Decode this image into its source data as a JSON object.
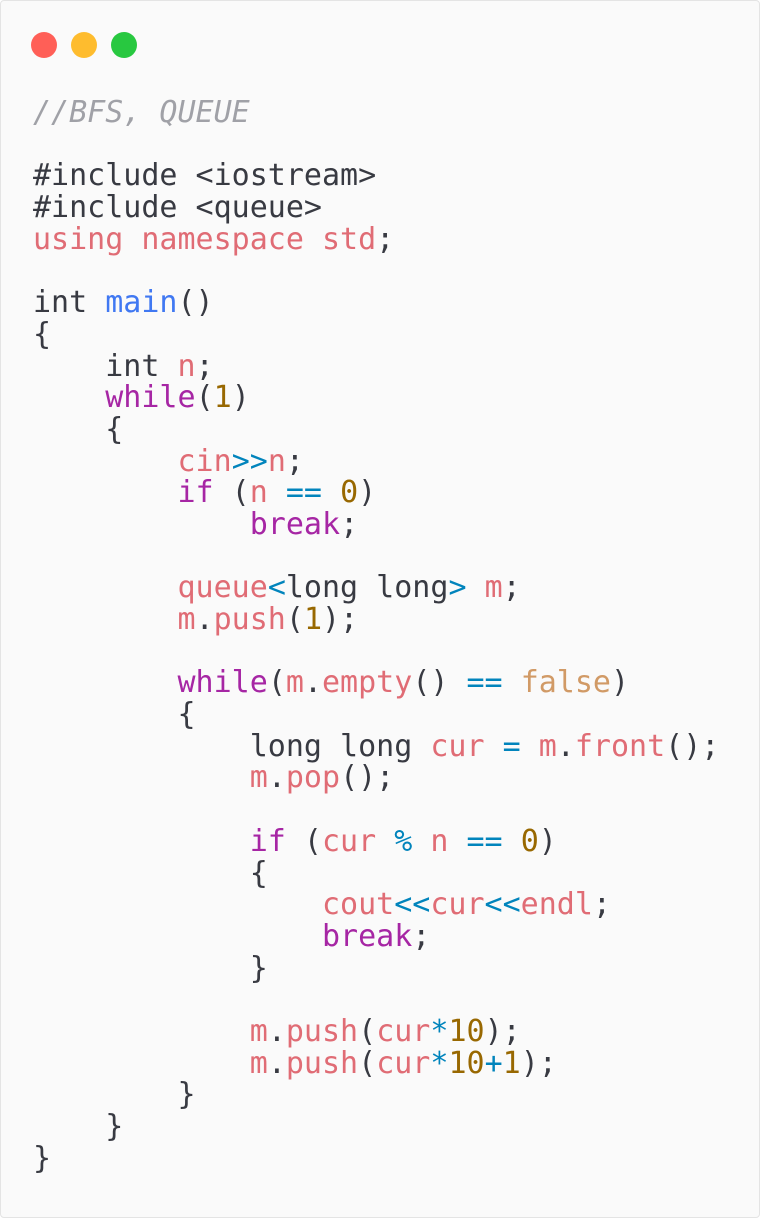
{
  "window": {
    "controls": {
      "close_color": "#ff5f57",
      "minimize_color": "#febc2e",
      "maximize_color": "#28c840"
    }
  },
  "code": {
    "language": "cpp",
    "lines": [
      [
        {
          "t": "//BFS, QUEUE",
          "c": "cm"
        }
      ],
      [],
      [
        {
          "t": "#include <iostream>",
          "c": "pl"
        }
      ],
      [
        {
          "t": "#include <queue>",
          "c": "pl"
        }
      ],
      [
        {
          "t": "using namespace std",
          "c": "id"
        },
        {
          "t": ";",
          "c": "pl"
        }
      ],
      [],
      [
        {
          "t": "int ",
          "c": "pl"
        },
        {
          "t": "main",
          "c": "fn"
        },
        {
          "t": "()",
          "c": "pl"
        }
      ],
      [
        {
          "t": "{",
          "c": "pl"
        }
      ],
      [
        {
          "t": "    int ",
          "c": "pl"
        },
        {
          "t": "n",
          "c": "id"
        },
        {
          "t": ";",
          "c": "pl"
        }
      ],
      [
        {
          "t": "    ",
          "c": "pl"
        },
        {
          "t": "while",
          "c": "kw"
        },
        {
          "t": "(",
          "c": "pl"
        },
        {
          "t": "1",
          "c": "num"
        },
        {
          "t": ")",
          "c": "pl"
        }
      ],
      [
        {
          "t": "    {",
          "c": "pl"
        }
      ],
      [
        {
          "t": "        ",
          "c": "pl"
        },
        {
          "t": "cin",
          "c": "id"
        },
        {
          "t": ">>",
          "c": "op"
        },
        {
          "t": "n",
          "c": "id"
        },
        {
          "t": ";",
          "c": "pl"
        }
      ],
      [
        {
          "t": "        ",
          "c": "pl"
        },
        {
          "t": "if",
          "c": "kw"
        },
        {
          "t": " (",
          "c": "pl"
        },
        {
          "t": "n",
          "c": "id"
        },
        {
          "t": " == ",
          "c": "op"
        },
        {
          "t": "0",
          "c": "num"
        },
        {
          "t": ")",
          "c": "pl"
        }
      ],
      [
        {
          "t": "            ",
          "c": "pl"
        },
        {
          "t": "break",
          "c": "kw"
        },
        {
          "t": ";",
          "c": "pl"
        }
      ],
      [],
      [
        {
          "t": "        ",
          "c": "pl"
        },
        {
          "t": "queue",
          "c": "id"
        },
        {
          "t": "<",
          "c": "op"
        },
        {
          "t": "long long",
          "c": "pl"
        },
        {
          "t": ">",
          "c": "op"
        },
        {
          "t": " ",
          "c": "pl"
        },
        {
          "t": "m",
          "c": "id"
        },
        {
          "t": ";",
          "c": "pl"
        }
      ],
      [
        {
          "t": "        ",
          "c": "pl"
        },
        {
          "t": "m",
          "c": "id"
        },
        {
          "t": ".",
          "c": "pl"
        },
        {
          "t": "push",
          "c": "id"
        },
        {
          "t": "(",
          "c": "pl"
        },
        {
          "t": "1",
          "c": "num"
        },
        {
          "t": ");",
          "c": "pl"
        }
      ],
      [],
      [
        {
          "t": "        ",
          "c": "pl"
        },
        {
          "t": "while",
          "c": "kw"
        },
        {
          "t": "(",
          "c": "pl"
        },
        {
          "t": "m",
          "c": "id"
        },
        {
          "t": ".",
          "c": "pl"
        },
        {
          "t": "empty",
          "c": "id"
        },
        {
          "t": "() ",
          "c": "pl"
        },
        {
          "t": "==",
          "c": "op"
        },
        {
          "t": " ",
          "c": "pl"
        },
        {
          "t": "false",
          "c": "bool"
        },
        {
          "t": ")",
          "c": "pl"
        }
      ],
      [
        {
          "t": "        {",
          "c": "pl"
        }
      ],
      [
        {
          "t": "            long long ",
          "c": "pl"
        },
        {
          "t": "cur",
          "c": "id"
        },
        {
          "t": " = ",
          "c": "op"
        },
        {
          "t": "m",
          "c": "id"
        },
        {
          "t": ".",
          "c": "pl"
        },
        {
          "t": "front",
          "c": "id"
        },
        {
          "t": "();",
          "c": "pl"
        }
      ],
      [
        {
          "t": "            ",
          "c": "pl"
        },
        {
          "t": "m",
          "c": "id"
        },
        {
          "t": ".",
          "c": "pl"
        },
        {
          "t": "pop",
          "c": "id"
        },
        {
          "t": "();",
          "c": "pl"
        }
      ],
      [],
      [
        {
          "t": "            ",
          "c": "pl"
        },
        {
          "t": "if",
          "c": "kw"
        },
        {
          "t": " (",
          "c": "pl"
        },
        {
          "t": "cur",
          "c": "id"
        },
        {
          "t": " % ",
          "c": "op"
        },
        {
          "t": "n",
          "c": "id"
        },
        {
          "t": " == ",
          "c": "op"
        },
        {
          "t": "0",
          "c": "num"
        },
        {
          "t": ")",
          "c": "pl"
        }
      ],
      [
        {
          "t": "            {",
          "c": "pl"
        }
      ],
      [
        {
          "t": "                ",
          "c": "pl"
        },
        {
          "t": "cout",
          "c": "id"
        },
        {
          "t": "<<",
          "c": "op"
        },
        {
          "t": "cur",
          "c": "id"
        },
        {
          "t": "<<",
          "c": "op"
        },
        {
          "t": "endl",
          "c": "id"
        },
        {
          "t": ";",
          "c": "pl"
        }
      ],
      [
        {
          "t": "                ",
          "c": "pl"
        },
        {
          "t": "break",
          "c": "kw"
        },
        {
          "t": ";",
          "c": "pl"
        }
      ],
      [
        {
          "t": "            }",
          "c": "pl"
        }
      ],
      [],
      [
        {
          "t": "            ",
          "c": "pl"
        },
        {
          "t": "m",
          "c": "id"
        },
        {
          "t": ".",
          "c": "pl"
        },
        {
          "t": "push",
          "c": "id"
        },
        {
          "t": "(",
          "c": "pl"
        },
        {
          "t": "cur",
          "c": "id"
        },
        {
          "t": "*",
          "c": "op"
        },
        {
          "t": "10",
          "c": "num"
        },
        {
          "t": ");",
          "c": "pl"
        }
      ],
      [
        {
          "t": "            ",
          "c": "pl"
        },
        {
          "t": "m",
          "c": "id"
        },
        {
          "t": ".",
          "c": "pl"
        },
        {
          "t": "push",
          "c": "id"
        },
        {
          "t": "(",
          "c": "pl"
        },
        {
          "t": "cur",
          "c": "id"
        },
        {
          "t": "*",
          "c": "op"
        },
        {
          "t": "10",
          "c": "num"
        },
        {
          "t": "+",
          "c": "op"
        },
        {
          "t": "1",
          "c": "num"
        },
        {
          "t": ");",
          "c": "pl"
        }
      ],
      [
        {
          "t": "        }",
          "c": "pl"
        }
      ],
      [
        {
          "t": "    }",
          "c": "pl"
        }
      ],
      [
        {
          "t": "}",
          "c": "pl"
        }
      ]
    ]
  }
}
